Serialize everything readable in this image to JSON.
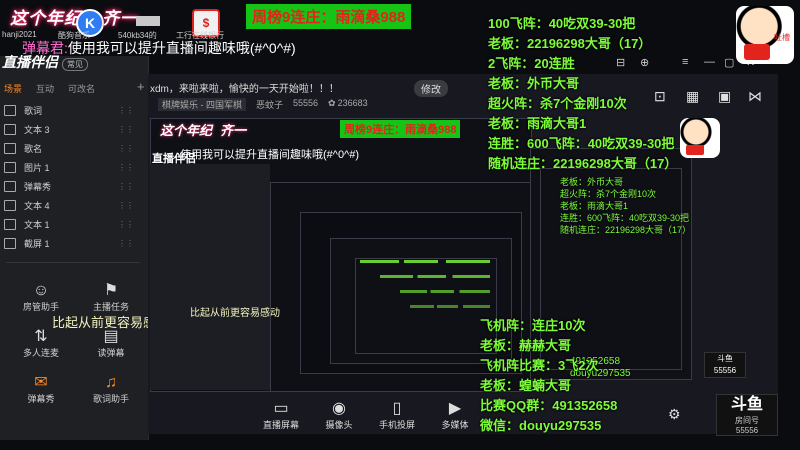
{
  "banner": {
    "title": "这个年纪",
    "k_letter": "K",
    "title_tail": "齐一",
    "icons": [
      {
        "name": "kugou",
        "label": "hanji2021",
        "bg": "#2a2a2a"
      },
      {
        "name": "music",
        "label": "酷狗音乐",
        "bg": "#2e7df2"
      },
      {
        "name": "app",
        "label": "540kb34的",
        "bg": "#8a8a8a"
      },
      {
        "name": "tool",
        "label": "工行在线银行",
        "bg": "#f1f1f1"
      }
    ],
    "weekly_streak": "周榜9连庄：雨滴桑988",
    "barrage_name": "弹幕君:",
    "barrage_text": "使用我可以提升直播间趣味哦(#^0^#)"
  },
  "app": {
    "logo": "直播伴侣",
    "badge": "常见",
    "tabs": [
      "场景",
      "互动",
      "可改名",
      "+"
    ],
    "active_tab": 0,
    "sources": [
      "歌词",
      "文本 3",
      "歌名",
      "图片 1",
      "弹幕秀",
      "文本 4",
      "文本 1",
      "截屏 1"
    ],
    "tools": [
      {
        "label": "房管助手",
        "glyph": "☺"
      },
      {
        "label": "主播任务",
        "glyph": "⚑"
      },
      {
        "label": "多人连麦",
        "glyph": "⇅"
      },
      {
        "label": "读弹幕",
        "glyph": "▤"
      },
      {
        "label": "弹幕秀",
        "glyph": "✉"
      },
      {
        "label": "歌词助手",
        "glyph": "♫"
      }
    ],
    "caption": "比起从前更容易感动",
    "room_title": "xdm，来啦来啦，愉快的一天开始啦！！！",
    "edit_label": "修改",
    "category": "棋牌娱乐 - 四国军棋",
    "host_name": "恶蚊子",
    "room_id": "55556",
    "fans": "236683",
    "bottom_tools": [
      {
        "label": "直播屏幕",
        "glyph": "▭"
      },
      {
        "label": "摄像头",
        "glyph": "◉"
      },
      {
        "label": "手机投屏",
        "glyph": "▯"
      },
      {
        "label": "多媒体",
        "glyph": "▶"
      }
    ]
  },
  "overlay": {
    "lines": [
      "100飞阵：40吃双39-30把",
      "老板：22196298大哥（17）",
      "2飞阵：20连胜",
      "老板：外币大哥",
      "超火阵：杀7个金刚10次",
      "老板：雨滴大哥1",
      "连胜：600飞阵：40吃双39-30把",
      "随机连庄：22196298大哥（17）"
    ],
    "bottom_lines": [
      "飞机阵：连庄10次",
      "老板：赫赫大哥",
      "飞机阵比赛：3飞2次",
      "老板：蝗蝻大哥",
      "比赛QQ群：491352658",
      "微信：douyu297535"
    ],
    "small_qq": "491352658",
    "small_wx": "douyu297535"
  },
  "douyu": {
    "logo": "斗鱼",
    "sub": "房间号",
    "id": "55556"
  },
  "colors": {
    "accent": "#ff8a1f",
    "green": "#7dfc3a",
    "streak_bg": "#16c416",
    "streak_fg": "#e2241c"
  }
}
